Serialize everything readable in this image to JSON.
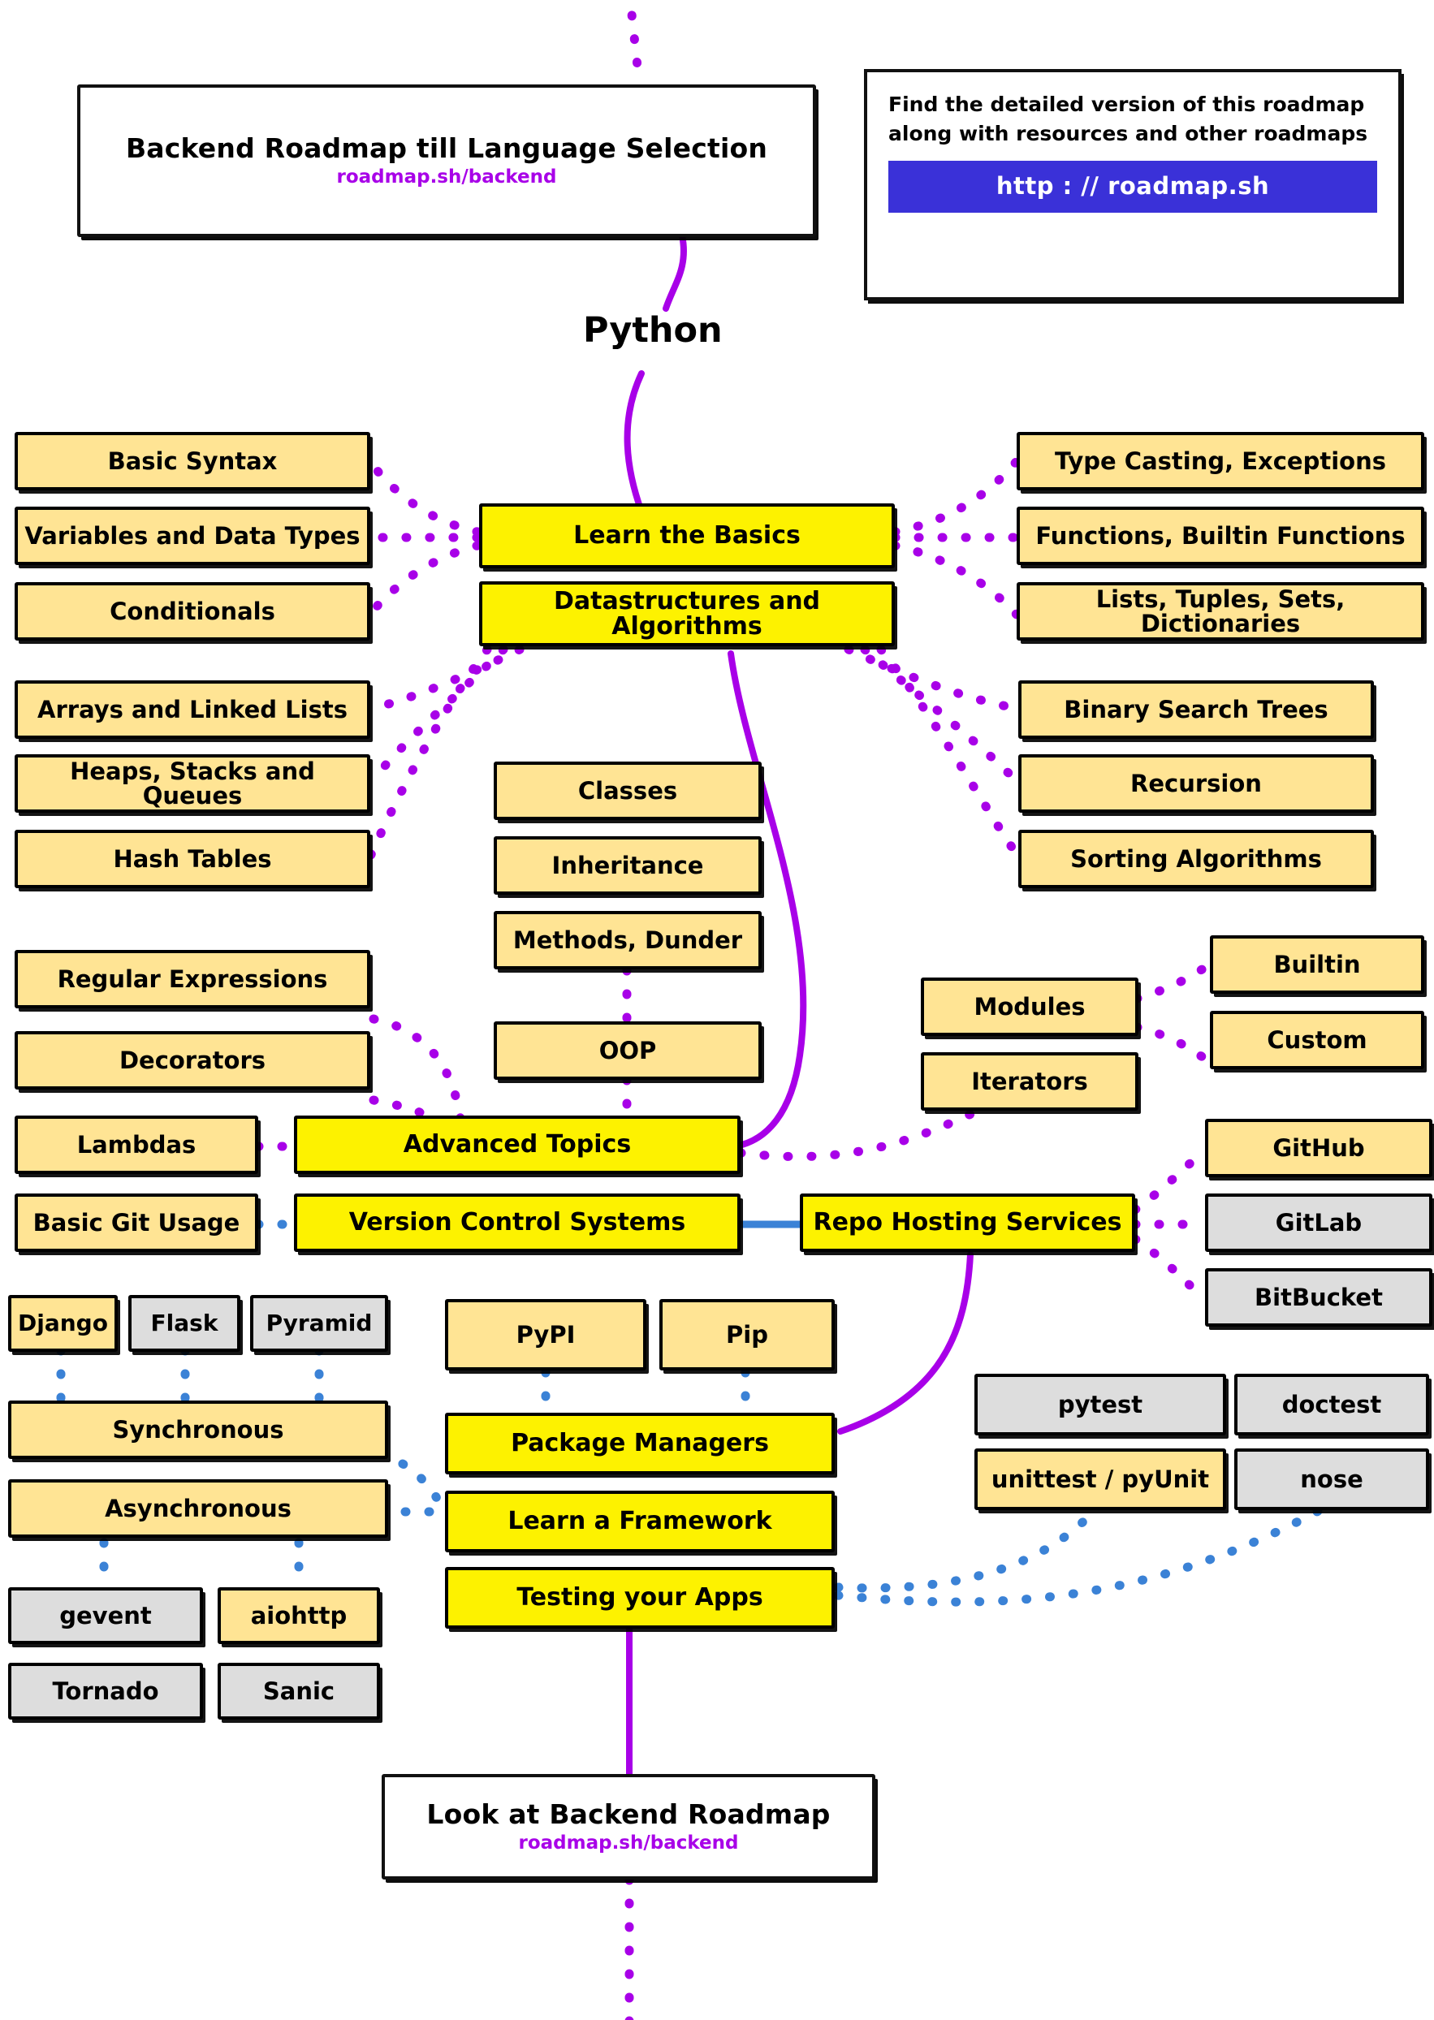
{
  "header": {
    "title_box": {
      "title": "Backend Roadmap till Language Selection",
      "url": "roadmap.sh/backend"
    },
    "info_box": {
      "line1": "Find the detailed version of this roadmap",
      "line2": "along with resources and other roadmaps",
      "button_label": "http : // roadmap.sh"
    }
  },
  "page_heading": "Python",
  "footer": {
    "title": "Look at Backend Roadmap",
    "url": "roadmap.sh/backend"
  },
  "colors": {
    "tan": "#ffe494",
    "yellow": "#fdf200",
    "grey": "#dddddd",
    "purple_link": "#a800e8",
    "blue_link": "#3b82d6",
    "button_blue": "#3a31d8",
    "outline": "#000000"
  },
  "nodes": {
    "learn_the_basics": "Learn the Basics",
    "datastructures_and_algorithms": "Datastructures and Algorithms",
    "basic_syntax": "Basic Syntax",
    "variables_and_data_types": "Variables and Data Types",
    "conditionals": "Conditionals",
    "type_casting_exceptions": "Type Casting, Exceptions",
    "functions_builtin_functions": "Functions, Builtin Functions",
    "lists_tuples_sets_dictionaries": "Lists, Tuples, Sets, Dictionaries",
    "arrays_and_linked_lists": "Arrays and Linked Lists",
    "heaps_stacks_and_queues": "Heaps, Stacks and Queues",
    "hash_tables": "Hash Tables",
    "binary_search_trees": "Binary Search Trees",
    "recursion": "Recursion",
    "sorting_algorithms": "Sorting Algorithms",
    "classes": "Classes",
    "inheritance": "Inheritance",
    "methods_dunder": "Methods, Dunder",
    "oop": "OOP",
    "regular_expressions": "Regular Expressions",
    "decorators": "Decorators",
    "lambdas": "Lambdas",
    "advanced_topics": "Advanced Topics",
    "modules": "Modules",
    "iterators": "Iterators",
    "builtin": "Builtin",
    "custom": "Custom",
    "basic_git_usage": "Basic Git Usage",
    "version_control_systems": "Version Control Systems",
    "repo_hosting_services": "Repo Hosting Services",
    "github": "GitHub",
    "gitlab": "GitLab",
    "bitbucket": "BitBucket",
    "django": "Django",
    "flask": "Flask",
    "pyramid": "Pyramid",
    "synchronous": "Synchronous",
    "asynchronous": "Asynchronous",
    "gevent": "gevent",
    "aiohttp": "aiohttp",
    "tornado": "Tornado",
    "sanic": "Sanic",
    "pypi": "PyPI",
    "pip": "Pip",
    "package_managers": "Package Managers",
    "learn_a_framework": "Learn a Framework",
    "testing_your_apps": "Testing your Apps",
    "pytest": "pytest",
    "doctest": "doctest",
    "unittest_pyunit": "unittest / pyUnit",
    "nose": "nose"
  }
}
